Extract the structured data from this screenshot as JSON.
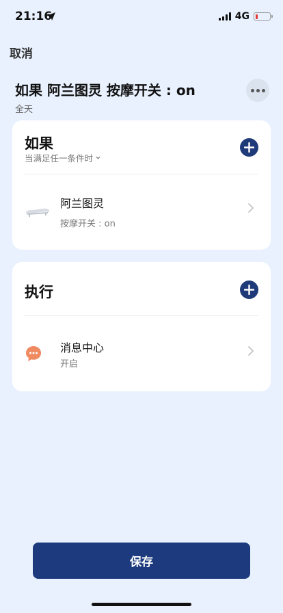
{
  "status": {
    "time": "21:16",
    "network": "4G",
    "battery_level": 0.15,
    "battery_color": "#e53935"
  },
  "header": {
    "cancel_label": "取消",
    "title": "如果 阿兰图灵 按摩开关 : on",
    "subtitle": "全天",
    "more_icon": "more-icon"
  },
  "if_section": {
    "heading": "如果",
    "condition_mode": "当满足任一条件时",
    "items": [
      {
        "icon": "bed-icon",
        "title": "阿兰图灵",
        "subtitle": "按摩开关 : on"
      }
    ]
  },
  "do_section": {
    "heading": "执行",
    "items": [
      {
        "icon": "message-icon",
        "icon_color": "#ef8a61",
        "title": "消息中心",
        "subtitle": "开启"
      }
    ]
  },
  "footer": {
    "save_label": "保存"
  },
  "colors": {
    "background": "#e8f1fd",
    "accent": "#1c3a7d",
    "card": "#ffffff"
  }
}
